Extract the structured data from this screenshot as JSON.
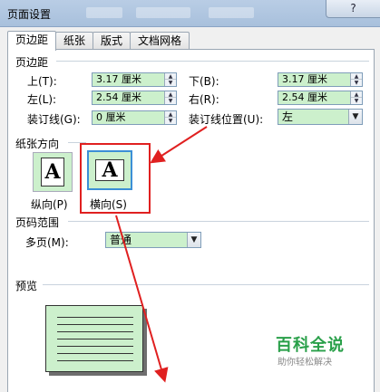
{
  "window": {
    "title": "页面设置",
    "help_label": "?"
  },
  "tabs": [
    {
      "label": "页边距",
      "active": true
    },
    {
      "label": "纸张",
      "active": false
    },
    {
      "label": "版式",
      "active": false
    },
    {
      "label": "文档网格",
      "active": false
    }
  ],
  "margins": {
    "group_title": "页边距",
    "top_label": "上(T):",
    "top_value": "3.17 厘米",
    "bottom_label": "下(B):",
    "bottom_value": "3.17 厘米",
    "left_label": "左(L):",
    "left_value": "2.54 厘米",
    "right_label": "右(R):",
    "right_value": "2.54 厘米",
    "gutter_label": "装订线(G):",
    "gutter_value": "0 厘米",
    "gutter_pos_label": "装订线位置(U):",
    "gutter_pos_value": "左"
  },
  "orientation": {
    "group_title": "纸张方向",
    "portrait_label": "纵向(P)",
    "landscape_label": "横向(S)",
    "glyph": "A",
    "selected": "landscape"
  },
  "pages": {
    "group_title": "页码范围",
    "multiple_label": "多页(M):",
    "multiple_value": "普通"
  },
  "preview": {
    "group_title": "预览"
  },
  "watermark": {
    "title": "百科全说",
    "subtitle": "助你轻松解决"
  },
  "colors": {
    "field_bg": "#ccf0cc",
    "highlight": "#e02020",
    "watermark": "#2aa04a"
  }
}
